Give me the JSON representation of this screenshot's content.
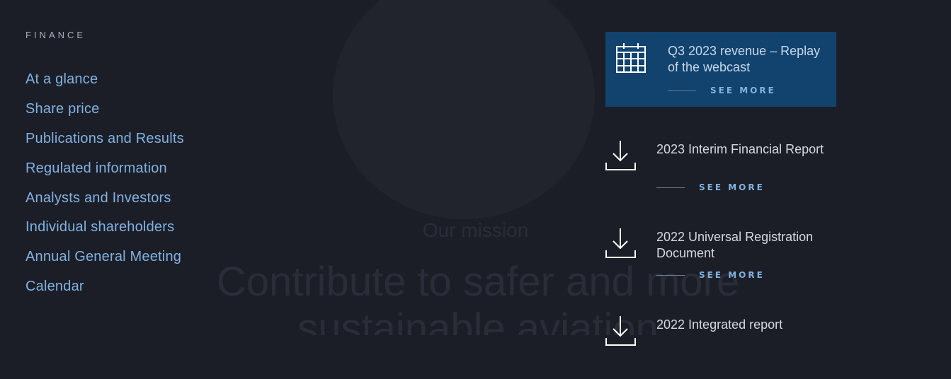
{
  "background": {
    "mission_heading": "Our mission",
    "tagline": "Contribute to safer and more sustainable aviation"
  },
  "finance": {
    "section_label": "FINANCE",
    "links": [
      "At a glance",
      "Share price",
      "Publications and Results",
      "Regulated information",
      "Analysts and Investors",
      "Individual shareholders",
      "Annual General Meeting",
      "Calendar"
    ]
  },
  "featured": {
    "icon": "calendar-icon",
    "title": "Q3 2023 revenue – Replay of the webcast",
    "cta": "SEE MORE"
  },
  "documents": [
    {
      "icon": "download-icon",
      "title": "2023 Interim Financial Report",
      "cta": "SEE MORE"
    },
    {
      "icon": "download-icon",
      "title": "2022 Universal Registration Document",
      "cta": "SEE MORE"
    },
    {
      "icon": "download-icon",
      "title": "2022 Integrated report",
      "cta": ""
    }
  ],
  "colors": {
    "page_background": "#1c1e27",
    "link": "#7fb2e2",
    "featured_card": "#12436f",
    "text_light": "#d4d8e2"
  }
}
